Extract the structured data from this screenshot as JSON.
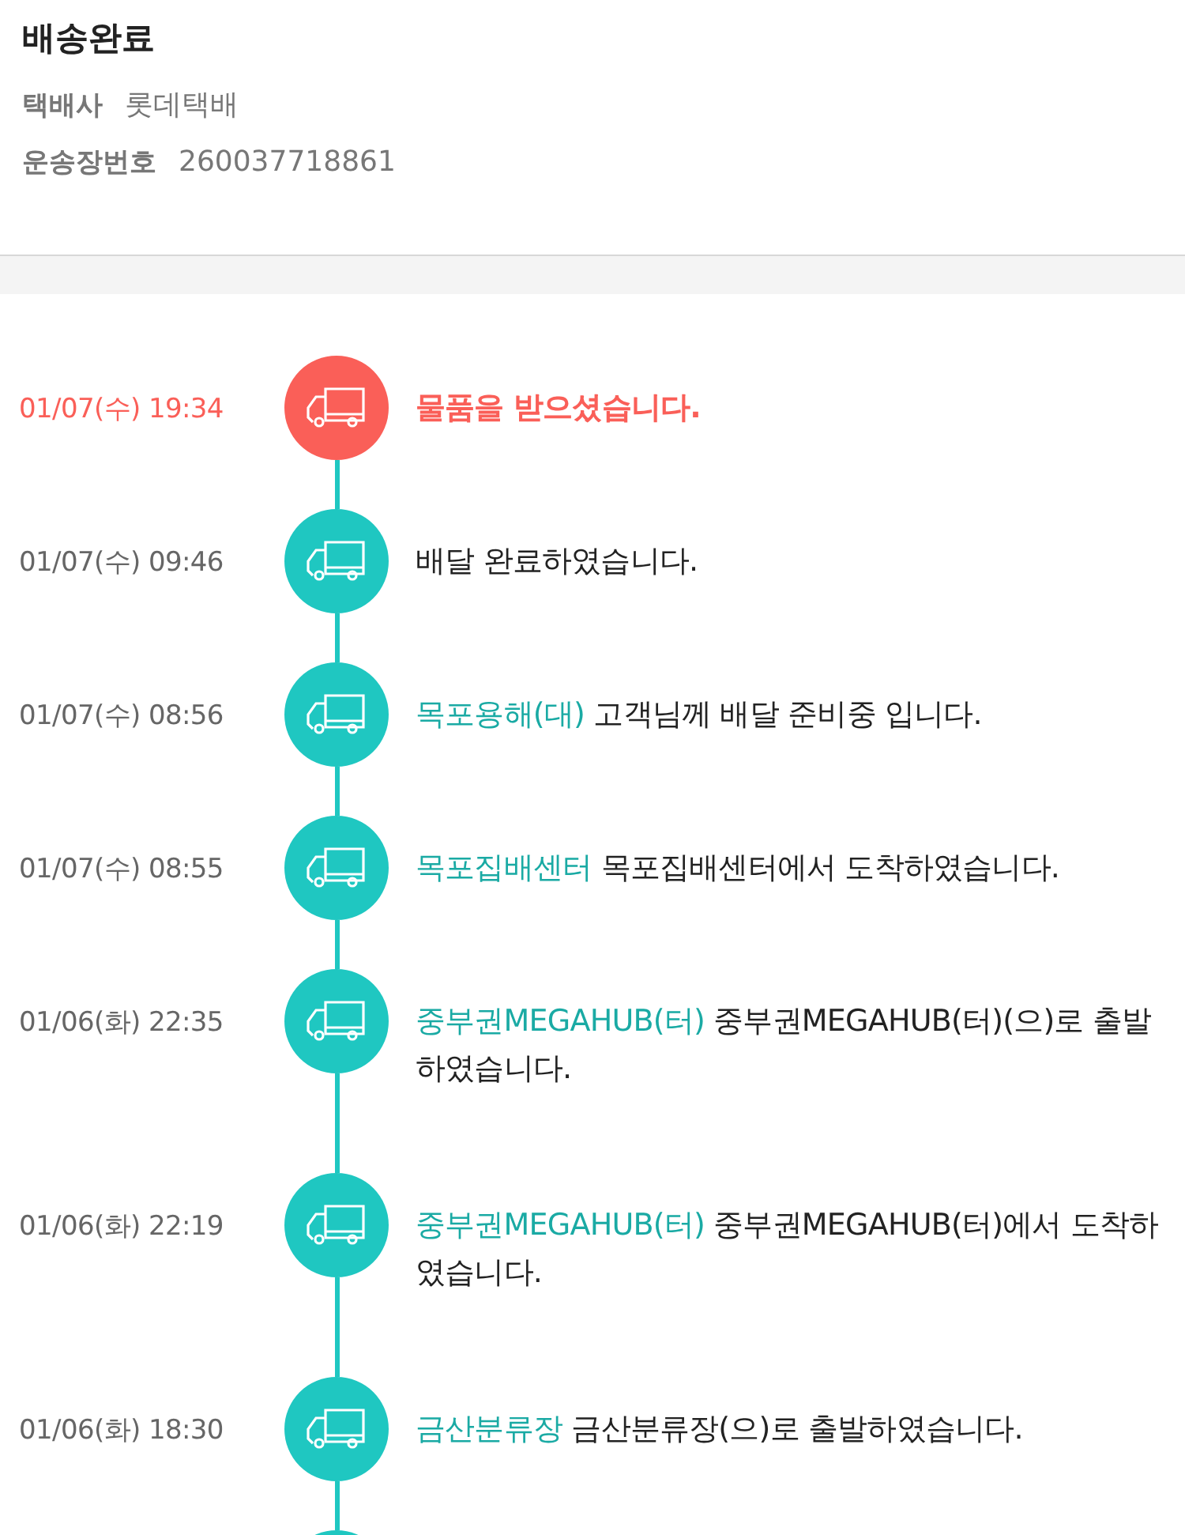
{
  "header": {
    "title": "배송완료",
    "fields": [
      {
        "label": "택배사",
        "value": "롯데택배"
      },
      {
        "label": "운송장번호",
        "value": "260037718861"
      }
    ]
  },
  "timeline": [
    {
      "time": "01/07(수) 19:34",
      "message": "물품을 받으셨습니다.",
      "current": true
    },
    {
      "time": "01/07(수) 09:46",
      "message": "배달 완료하였습니다.",
      "current": false
    },
    {
      "time": "01/07(수) 08:56",
      "location": "목포용해(대)",
      "message": "고객님께 배달 준비중 입니다.",
      "current": false
    },
    {
      "time": "01/07(수) 08:55",
      "location": "목포집배센터",
      "message": "목포집배센터에서 도착하였습니다.",
      "current": false
    },
    {
      "time": "01/06(화) 22:35",
      "location": "중부권MEGAHUB(터)",
      "message": "중부권MEGAHUB(터)(으)로 출발하였습니다.",
      "current": false
    },
    {
      "time": "01/06(화) 22:19",
      "location": "중부권MEGAHUB(터)",
      "message": "중부권MEGAHUB(터)에서 도착하였습니다.",
      "current": false
    },
    {
      "time": "01/06(화) 18:30",
      "location": "금산분류장",
      "message": "금산분류장(으)로 출발하였습니다.",
      "current": false
    },
    {
      "current": false
    }
  ]
}
